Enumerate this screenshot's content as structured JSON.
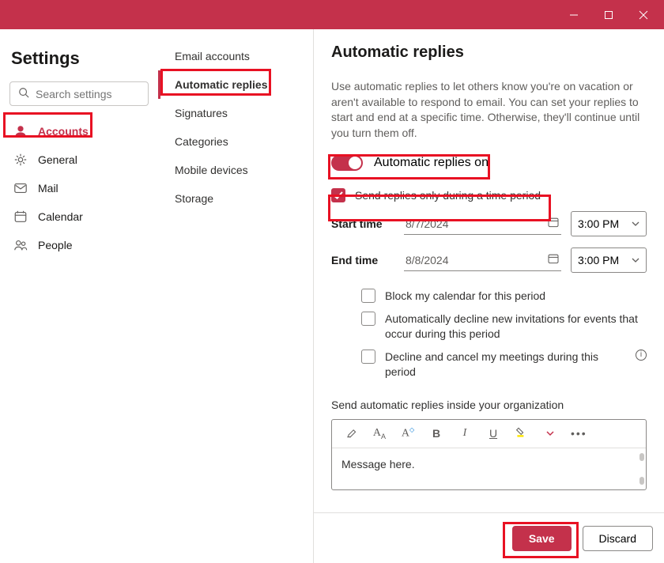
{
  "titlebar": {
    "min": "—",
    "close": "×"
  },
  "left": {
    "title": "Settings",
    "search_placeholder": "Search settings",
    "items": [
      {
        "label": "Accounts",
        "icon": "person-icon",
        "active": true
      },
      {
        "label": "General",
        "icon": "gear-icon"
      },
      {
        "label": "Mail",
        "icon": "mail-icon"
      },
      {
        "label": "Calendar",
        "icon": "calendar-icon"
      },
      {
        "label": "People",
        "icon": "people-icon"
      }
    ]
  },
  "middle": {
    "items": [
      "Email accounts",
      "Automatic replies",
      "Signatures",
      "Categories",
      "Mobile devices",
      "Storage"
    ],
    "active_index": 1
  },
  "main": {
    "title": "Automatic replies",
    "description": "Use automatic replies to let others know you're on vacation or aren't available to respond to email. You can set your replies to start and end at a specific time. Otherwise, they'll continue until you turn them off.",
    "toggle_label": "Automatic replies on",
    "toggle_on": true,
    "timeperiod_label": "Send replies only during a time period",
    "timeperiod_checked": true,
    "start_label": "Start time",
    "start_date": "8/7/2024",
    "start_time": "3:00 PM",
    "end_label": "End time",
    "end_date": "8/8/2024",
    "end_time": "3:00 PM",
    "opt_block": "Block my calendar for this period",
    "opt_decline": "Automatically decline new invitations for events that occur during this period",
    "opt_cancel": "Decline and cancel my meetings during this period",
    "section_label": "Send automatic replies inside your organization",
    "message_body": "Message here.",
    "fmt_bold": "B",
    "fmt_italic": "I",
    "fmt_underline": "U"
  },
  "footer": {
    "save": "Save",
    "discard": "Discard"
  }
}
